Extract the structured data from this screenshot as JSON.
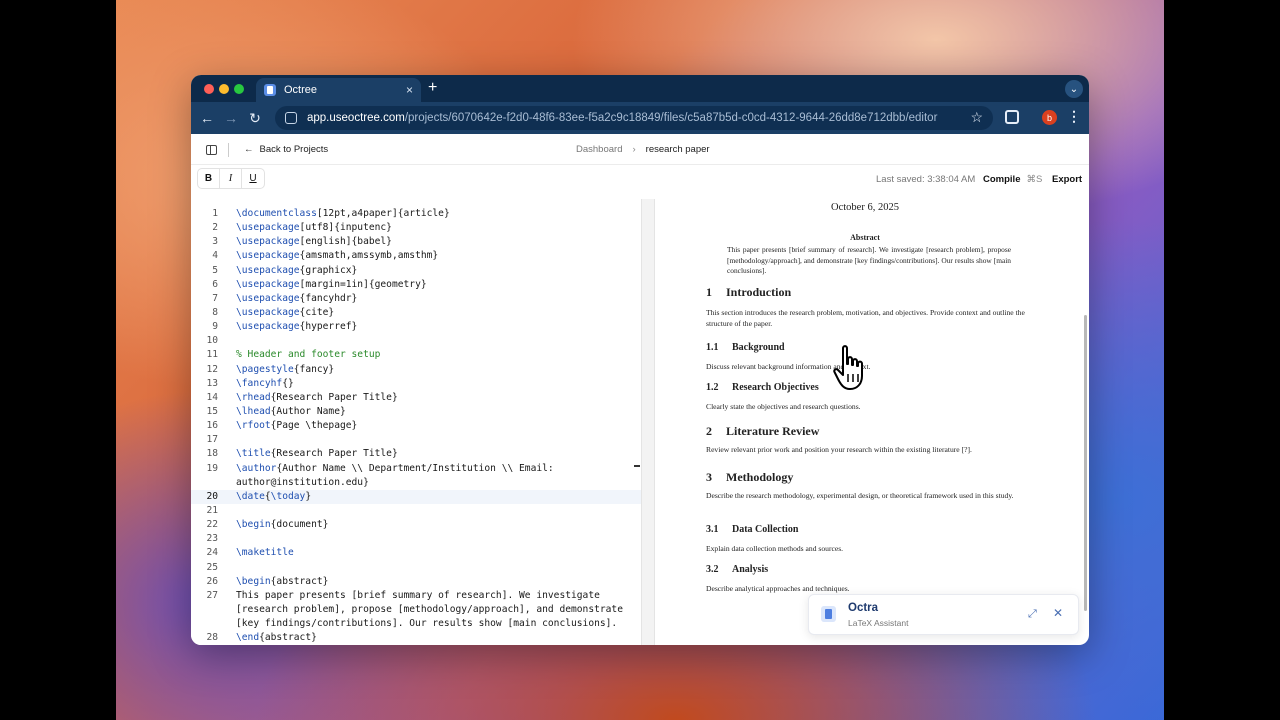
{
  "browser": {
    "tab_title": "Octree",
    "tab_close": "×",
    "new_tab": "+",
    "tab_menu": "⌄",
    "url_host": "app.useoctree.com",
    "url_path": "/projects/6070642e-f2d0-48f6-83ee-f5a2c9c18849/files/c5a87b5d-c0cd-4312-9644-26dd8e712dbb/editor",
    "profile_initial": "b"
  },
  "header": {
    "back_label": "Back to Projects",
    "breadcrumb": [
      "Dashboard",
      "research paper"
    ]
  },
  "toolbar": {
    "bold": "B",
    "italic": "I",
    "underline": "U",
    "last_saved": "Last saved: 3:38:04 AM",
    "compile": "Compile",
    "compile_shortcut": "⌘S",
    "export": "Export"
  },
  "editor": {
    "active_line": 20,
    "lines": [
      {
        "n": "1",
        "segments": [
          [
            "kw",
            "\\documentclass"
          ],
          [
            "t",
            "[12pt,a4paper]{article}"
          ]
        ]
      },
      {
        "n": "2",
        "segments": [
          [
            "kw",
            "\\usepackage"
          ],
          [
            "t",
            "[utf8]{inputenc}"
          ]
        ]
      },
      {
        "n": "3",
        "segments": [
          [
            "kw",
            "\\usepackage"
          ],
          [
            "t",
            "[english]{babel}"
          ]
        ]
      },
      {
        "n": "4",
        "segments": [
          [
            "kw",
            "\\usepackage"
          ],
          [
            "t",
            "{amsmath,amssymb,amsthm}"
          ]
        ]
      },
      {
        "n": "5",
        "segments": [
          [
            "kw",
            "\\usepackage"
          ],
          [
            "t",
            "{graphicx}"
          ]
        ]
      },
      {
        "n": "6",
        "segments": [
          [
            "kw",
            "\\usepackage"
          ],
          [
            "t",
            "[margin=1in]{geometry}"
          ]
        ]
      },
      {
        "n": "7",
        "segments": [
          [
            "kw",
            "\\usepackage"
          ],
          [
            "t",
            "{fancyhdr}"
          ]
        ]
      },
      {
        "n": "8",
        "segments": [
          [
            "kw",
            "\\usepackage"
          ],
          [
            "t",
            "{cite}"
          ]
        ]
      },
      {
        "n": "9",
        "segments": [
          [
            "kw",
            "\\usepackage"
          ],
          [
            "t",
            "{hyperref}"
          ]
        ]
      },
      {
        "n": "10",
        "segments": []
      },
      {
        "n": "11",
        "segments": [
          [
            "cm",
            "% Header and footer setup"
          ]
        ]
      },
      {
        "n": "12",
        "segments": [
          [
            "kw",
            "\\pagestyle"
          ],
          [
            "t",
            "{fancy}"
          ]
        ]
      },
      {
        "n": "13",
        "segments": [
          [
            "kw",
            "\\fancyhf"
          ],
          [
            "t",
            "{}"
          ]
        ]
      },
      {
        "n": "14",
        "segments": [
          [
            "kw",
            "\\rhead"
          ],
          [
            "t",
            "{Research Paper Title}"
          ]
        ]
      },
      {
        "n": "15",
        "segments": [
          [
            "kw",
            "\\lhead"
          ],
          [
            "t",
            "{Author Name}"
          ]
        ]
      },
      {
        "n": "16",
        "segments": [
          [
            "kw",
            "\\rfoot"
          ],
          [
            "t",
            "{Page \\thepage}"
          ]
        ]
      },
      {
        "n": "17",
        "segments": []
      },
      {
        "n": "18",
        "segments": [
          [
            "kw",
            "\\title"
          ],
          [
            "t",
            "{Research Paper Title}"
          ]
        ]
      },
      {
        "n": "19",
        "segments": [
          [
            "kw",
            "\\author"
          ],
          [
            "t",
            "{Author Name \\\\ Department/Institution \\\\ Email:"
          ]
        ]
      },
      {
        "n": "",
        "segments": [
          [
            "t",
            "author@institution.edu}"
          ]
        ]
      },
      {
        "n": "20",
        "segments": [
          [
            "kw",
            "\\date"
          ],
          [
            "t",
            "{"
          ],
          [
            "kw",
            "\\today"
          ],
          [
            "t",
            "}"
          ]
        ]
      },
      {
        "n": "21",
        "segments": []
      },
      {
        "n": "22",
        "segments": [
          [
            "kw",
            "\\begin"
          ],
          [
            "t",
            "{document}"
          ]
        ]
      },
      {
        "n": "23",
        "segments": []
      },
      {
        "n": "24",
        "segments": [
          [
            "kw",
            "\\maketitle"
          ]
        ]
      },
      {
        "n": "25",
        "segments": []
      },
      {
        "n": "26",
        "segments": [
          [
            "kw",
            "\\begin"
          ],
          [
            "t",
            "{abstract}"
          ]
        ]
      },
      {
        "n": "27",
        "segments": [
          [
            "t",
            "This paper presents [brief summary of research]. We investigate"
          ]
        ]
      },
      {
        "n": "",
        "segments": [
          [
            "t",
            "[research problem], propose [methodology/approach], and demonstrate"
          ]
        ]
      },
      {
        "n": "",
        "segments": [
          [
            "t",
            "[key findings/contributions]. Our results show [main conclusions]."
          ]
        ]
      },
      {
        "n": "28",
        "segments": [
          [
            "kw",
            "\\end"
          ],
          [
            "t",
            "{abstract}"
          ]
        ]
      }
    ]
  },
  "preview": {
    "date": "October 6, 2025",
    "abstract_title": "Abstract",
    "abstract_text": "This paper presents [brief summary of research]. We investigate [research problem], propose [methodology/approach], and demonstrate [key findings/contributions]. Our results show [main conclusions].",
    "blocks": [
      {
        "type": "h1",
        "num": "1",
        "title": "Introduction"
      },
      {
        "type": "para",
        "text": "This section introduces the research problem, motivation, and objectives. Provide context and outline the structure of the paper."
      },
      {
        "type": "h2",
        "num": "1.1",
        "title": "Background"
      },
      {
        "type": "para",
        "text": "Discuss relevant background information and context."
      },
      {
        "type": "h2",
        "num": "1.2",
        "title": "Research Objectives"
      },
      {
        "type": "para",
        "text": "Clearly state the objectives and research questions."
      },
      {
        "type": "h1",
        "num": "2",
        "title": "Literature Review"
      },
      {
        "type": "para",
        "text": "Review relevant prior work and position your research within the existing literature [?]."
      },
      {
        "type": "h1",
        "num": "3",
        "title": "Methodology"
      },
      {
        "type": "para",
        "text": "Describe the research methodology, experimental design, or theoretical framework used in this study."
      },
      {
        "type": "h2",
        "num": "3.1",
        "title": "Data Collection"
      },
      {
        "type": "para",
        "text": "Explain data collection methods and sources."
      },
      {
        "type": "h2",
        "num": "3.2",
        "title": "Analysis"
      },
      {
        "type": "para",
        "text": "Describe analytical approaches and techniques."
      }
    ]
  },
  "assistant": {
    "title": "Octra",
    "subtitle": "LaTeX Assistant"
  }
}
